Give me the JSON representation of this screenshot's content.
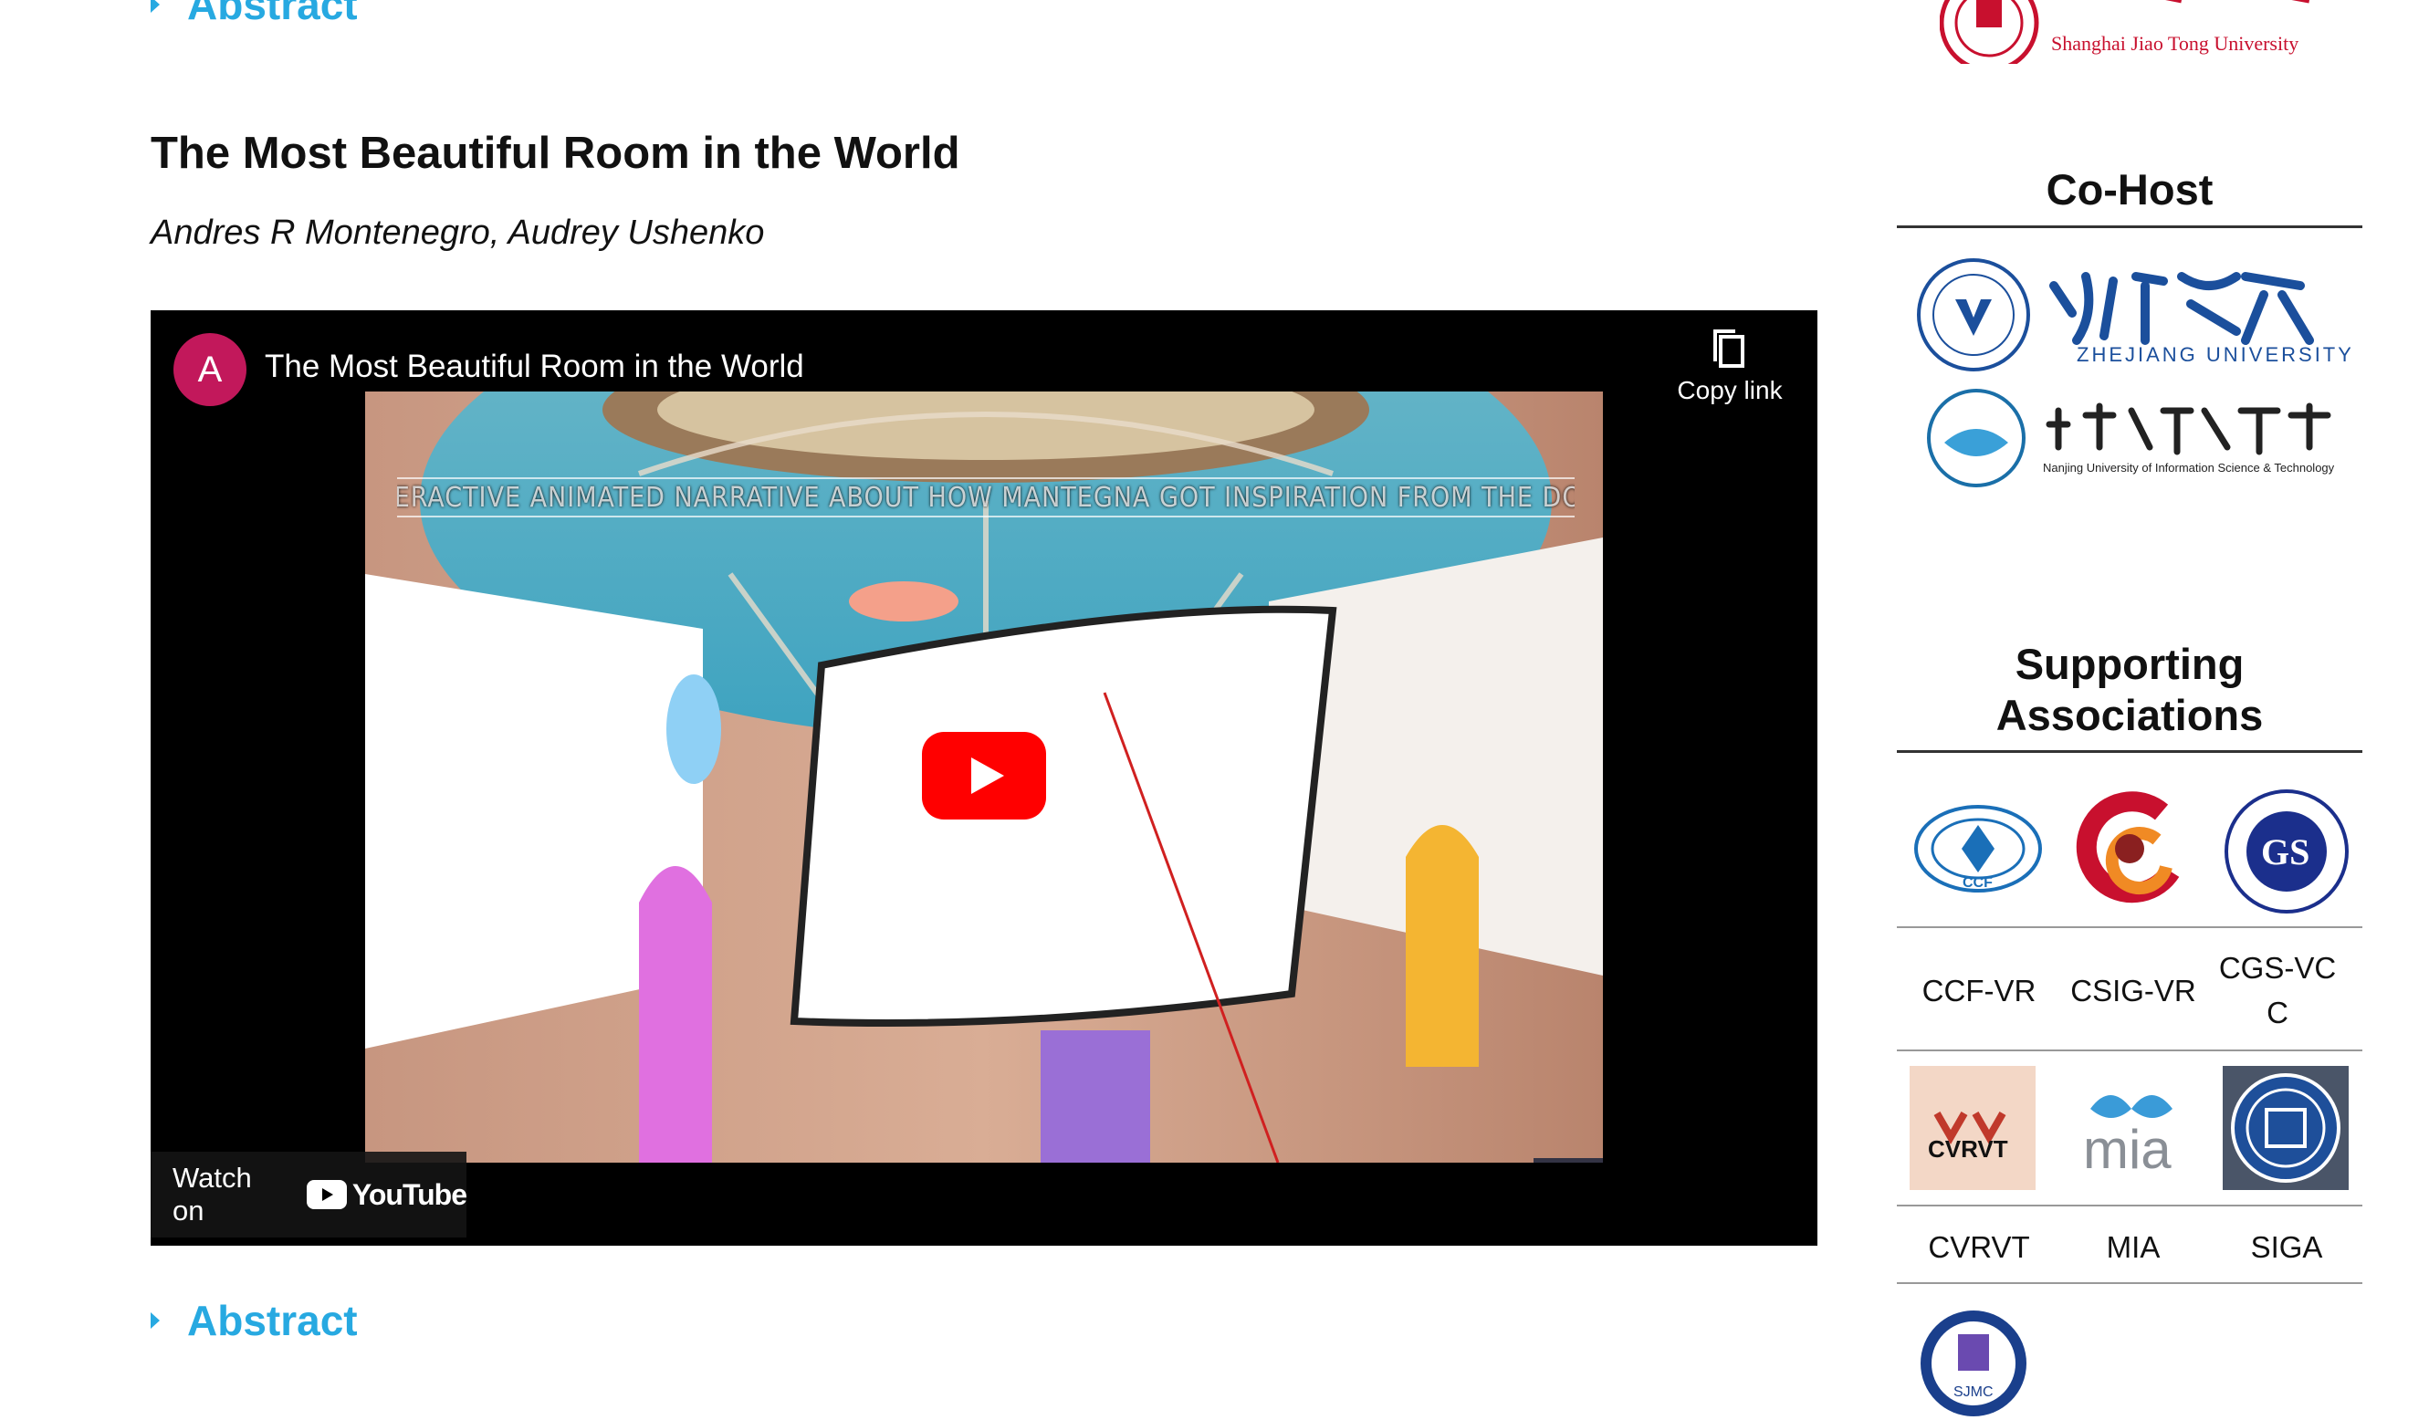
{
  "top_abstract_label": "Abstract",
  "paper": {
    "title": "The Most Beautiful Room in the World",
    "authors": "Andres R Montenegro, Audrey Ushenko",
    "abstract_label": "Abstract"
  },
  "video": {
    "channel_initial": "A",
    "title": "The Most Beautiful Room in the World",
    "copy_link_label": "Copy link",
    "subtitle": "INTERACTIVE ANIMATED NARRATIVE ABOUT HOW MANTEGNA GOT INSPIRATION FROM THE DOME",
    "watch_on_label": "Watch on",
    "youtube_label": "YouTube"
  },
  "sidebar": {
    "host_logo_text": "Shanghai Jiao Tong University",
    "cohost_heading": "Co-Host",
    "cohost_logos": [
      {
        "name": "ZHEJIANG UNIVERSITY",
        "icon": "zhejiang-university-logo"
      },
      {
        "name": "Nanjing University of Information Science & Technology",
        "icon": "nuist-logo"
      }
    ],
    "supporting_heading": "Supporting Associations",
    "associations": [
      {
        "label": "CCF-VR",
        "icon": "ccf-logo"
      },
      {
        "label": "CSIG-VR",
        "icon": "csig-logo"
      },
      {
        "label": "CGS-VCC",
        "icon": "cgs-logo"
      },
      {
        "label": "CVRVT",
        "icon": "cvrvt-logo"
      },
      {
        "label": "MIA",
        "icon": "mia-logo"
      },
      {
        "label": "SIGA",
        "icon": "siga-logo"
      },
      {
        "label": "SJMC",
        "icon": "sjmc-logo"
      }
    ]
  }
}
